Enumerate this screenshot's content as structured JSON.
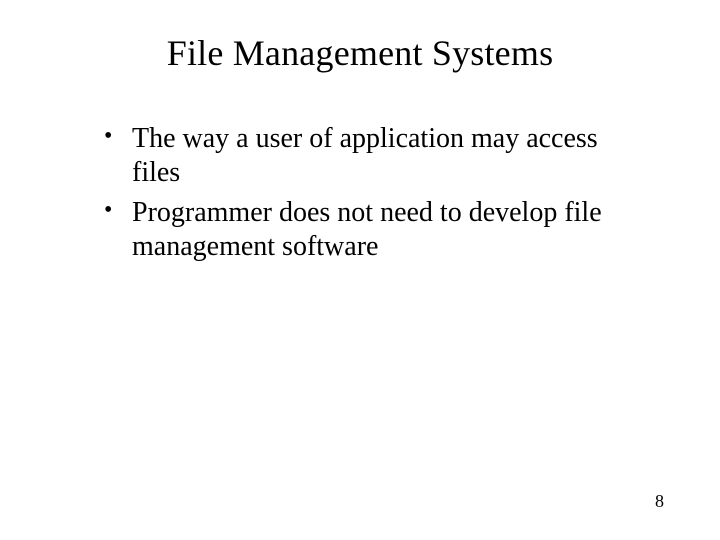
{
  "slide": {
    "title": "File Management Systems",
    "bullets": [
      "The way a user of application may access files",
      "Programmer does not need to develop file management software"
    ],
    "page_number": "8"
  }
}
